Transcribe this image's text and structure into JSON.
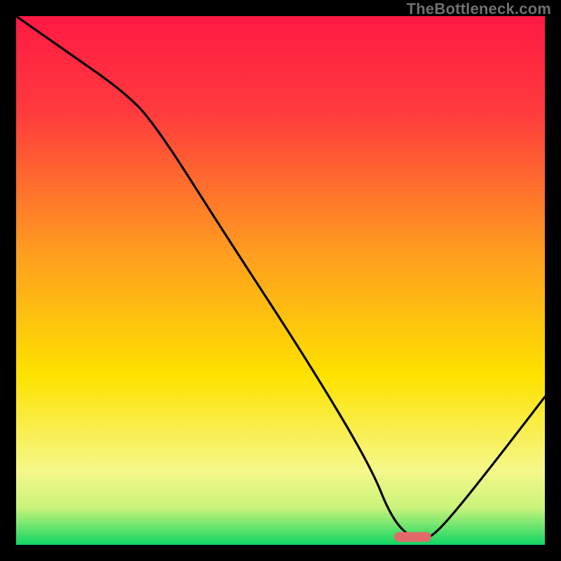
{
  "watermark": "TheBottleneck.com",
  "chart_data": {
    "type": "line",
    "title": "",
    "xlabel": "",
    "ylabel": "",
    "xlim": [
      0,
      100
    ],
    "ylim": [
      0,
      100
    ],
    "grid": false,
    "legend": false,
    "background": {
      "top_color": "#ff1a44",
      "mid_color": "#fee200",
      "bottom_color": "#0fd663"
    },
    "curve": {
      "comment": "V-shaped bottleneck curve starting at top-left, kinking near (26,80), descending near-linearly to a flat minimum around x≈72-78, then rising to the right edge at roughly y≈28.",
      "x": [
        0,
        10,
        20,
        26,
        40,
        55,
        67,
        71,
        75,
        78,
        82,
        90,
        100
      ],
      "y": [
        100,
        93,
        86,
        80,
        58,
        35,
        15,
        5,
        1,
        1,
        5,
        15,
        28
      ]
    },
    "marker": {
      "comment": "Rounded red segment marking the optimal (minimum bottleneck) region on the curve.",
      "x_start": 71.5,
      "x_end": 78.5,
      "y": 1.5,
      "color": "#e26a6a"
    }
  }
}
